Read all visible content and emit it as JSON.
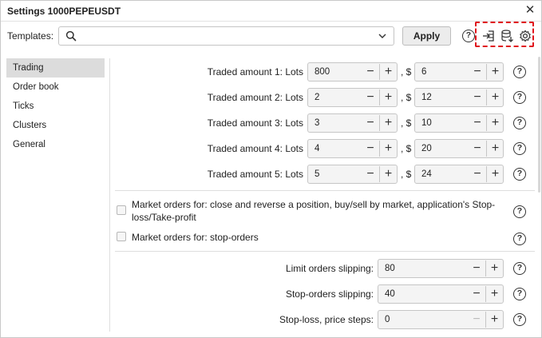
{
  "window": {
    "title": "Settings 1000PEPEUSDT",
    "close_glyph": "✕"
  },
  "templates": {
    "label": "Templates:",
    "search_value": "",
    "search_placeholder": "",
    "apply_label": "Apply",
    "help_glyph": "?",
    "icons": [
      "help-icon",
      "import-template-icon",
      "save-template-icon",
      "template-settings-icon"
    ],
    "highlight_color": "#e0141c"
  },
  "sidebar": {
    "items": [
      {
        "label": "Trading",
        "active": true
      },
      {
        "label": "Order book",
        "active": false
      },
      {
        "label": "Ticks",
        "active": false
      },
      {
        "label": "Clusters",
        "active": false
      },
      {
        "label": "General",
        "active": false
      }
    ]
  },
  "trading": {
    "lot_rows": [
      {
        "label": "Traded amount 1: Lots",
        "lots": "800",
        "sep": ", $",
        "usd": "6"
      },
      {
        "label": "Traded amount 2: Lots",
        "lots": "2",
        "sep": ", $",
        "usd": "12"
      },
      {
        "label": "Traded amount 3: Lots",
        "lots": "3",
        "sep": ", $",
        "usd": "10"
      },
      {
        "label": "Traded amount 4: Lots",
        "lots": "4",
        "sep": ", $",
        "usd": "20"
      },
      {
        "label": "Traded amount 5: Lots",
        "lots": "5",
        "sep": ", $",
        "usd": "24"
      }
    ],
    "checkboxes": [
      {
        "label": "Market orders for: close and reverse a position, buy/sell by market, application's Stop-loss/Take-profit",
        "checked": false
      },
      {
        "label": "Market orders for: stop-orders",
        "checked": false
      }
    ],
    "slip_rows": [
      {
        "label": "Limit orders slipping:",
        "value": "80"
      },
      {
        "label": "Stop-orders slipping:",
        "value": "40"
      },
      {
        "label": "Stop-loss, price steps:",
        "value": "0",
        "minus_disabled": true
      }
    ],
    "minus_glyph": "−",
    "plus_glyph": "+",
    "help_glyph": "?"
  }
}
